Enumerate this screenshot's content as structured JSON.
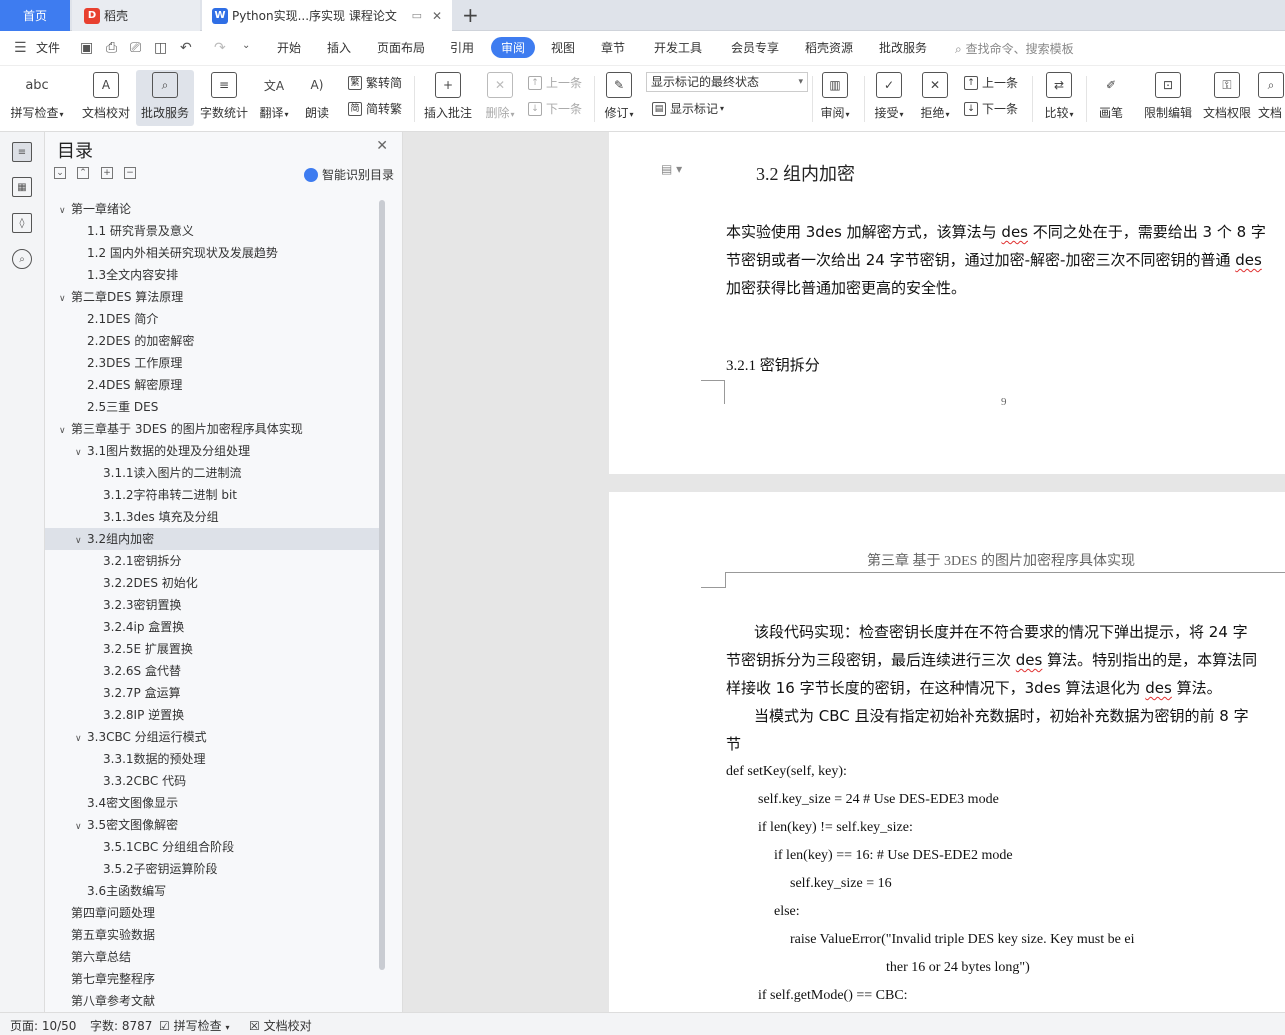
{
  "tabs": {
    "home": "首页",
    "daoke": "稻壳",
    "doc": "Python实现...序实现 课程论文",
    "add": "+"
  },
  "menubar": {
    "file": "文件",
    "items": [
      "开始",
      "插入",
      "页面布局",
      "引用",
      "审阅",
      "视图",
      "章节",
      "开发工具",
      "会员专享",
      "稻壳资源",
      "批改服务"
    ],
    "active": "审阅",
    "search": "查找命令、搜索模板"
  },
  "ribbon": {
    "spell": "拼写检查",
    "doc_check": "文档校对",
    "correct_service": "批改服务",
    "word_count": "字数统计",
    "translate": "翻译",
    "read_aloud": "朗读",
    "trad": "繁转简",
    "simp": "简转繁",
    "insert_comment": "插入批注",
    "delete": "删除",
    "prev": "上一条",
    "next": "下一条",
    "revise": "修订",
    "markup_state": "显示标记的最终状态",
    "show_markup": "显示标记",
    "review": "审阅",
    "accept": "接受",
    "reject": "拒绝",
    "prev2": "上一条",
    "next2": "下一条",
    "compare": "比较",
    "pen": "画笔",
    "restrict": "限制编辑",
    "permission": "文档权限",
    "more": "文档"
  },
  "toc": {
    "title": "目录",
    "smart": "智能识别目录",
    "items": [
      {
        "label": "第一章绪论",
        "level": 0,
        "caret": "∨"
      },
      {
        "label": "1.1  研究背景及意义",
        "level": 1,
        "caret": ""
      },
      {
        "label": "1.2    国内外相关研究现状及发展趋势",
        "level": 1,
        "caret": ""
      },
      {
        "label": "1.3全文内容安排",
        "level": 1,
        "caret": ""
      },
      {
        "label": "第二章DES 算法原理",
        "level": 0,
        "caret": "∨"
      },
      {
        "label": "2.1DES 简介",
        "level": 1,
        "caret": ""
      },
      {
        "label": "2.2DES 的加密解密",
        "level": 1,
        "caret": ""
      },
      {
        "label": "2.3DES 工作原理",
        "level": 1,
        "caret": ""
      },
      {
        "label": "2.4DES 解密原理",
        "level": 1,
        "caret": ""
      },
      {
        "label": "2.5三重 DES",
        "level": 1,
        "caret": ""
      },
      {
        "label": "第三章基于 3DES 的图片加密程序具体实现",
        "level": 0,
        "caret": "∨"
      },
      {
        "label": "3.1图片数据的处理及分组处理",
        "level": 1,
        "caret": "∨"
      },
      {
        "label": "3.1.1读入图片的二进制流",
        "level": 2,
        "caret": ""
      },
      {
        "label": "3.1.2字符串转二进制 bit",
        "level": 2,
        "caret": ""
      },
      {
        "label": "3.1.3des 填充及分组",
        "level": 2,
        "caret": ""
      },
      {
        "label": "3.2组内加密",
        "level": 1,
        "caret": "∨",
        "selected": true
      },
      {
        "label": "3.2.1密钥拆分",
        "level": 2,
        "caret": ""
      },
      {
        "label": "3.2.2DES 初始化",
        "level": 2,
        "caret": ""
      },
      {
        "label": "3.2.3密钥置换",
        "level": 2,
        "caret": ""
      },
      {
        "label": "3.2.4ip 盒置换",
        "level": 2,
        "caret": ""
      },
      {
        "label": "3.2.5E 扩展置换",
        "level": 2,
        "caret": ""
      },
      {
        "label": "3.2.6S 盒代替",
        "level": 2,
        "caret": ""
      },
      {
        "label": "3.2.7P 盒运算",
        "level": 2,
        "caret": ""
      },
      {
        "label": "3.2.8IP 逆置换",
        "level": 2,
        "caret": ""
      },
      {
        "label": "3.3CBC 分组运行模式",
        "level": 1,
        "caret": "∨"
      },
      {
        "label": "3.3.1数据的预处理",
        "level": 2,
        "caret": ""
      },
      {
        "label": "3.3.2CBC 代码",
        "level": 2,
        "caret": ""
      },
      {
        "label": "3.4密文图像显示",
        "level": 1,
        "caret": ""
      },
      {
        "label": "3.5密文图像解密",
        "level": 1,
        "caret": "∨"
      },
      {
        "label": "3.5.1CBC 分组组合阶段",
        "level": 2,
        "caret": ""
      },
      {
        "label": "3.5.2子密钥运算阶段",
        "level": 2,
        "caret": ""
      },
      {
        "label": "3.6主函数编写",
        "level": 1,
        "caret": ""
      },
      {
        "label": "第四章问题处理",
        "level": 0,
        "caret": ""
      },
      {
        "label": "第五章实验数据",
        "level": 0,
        "caret": ""
      },
      {
        "label": "第六章总结",
        "level": 0,
        "caret": ""
      },
      {
        "label": "第七章完整程序",
        "level": 0,
        "caret": ""
      },
      {
        "label": "第八章参考文献",
        "level": 0,
        "caret": ""
      }
    ]
  },
  "page1": {
    "heading": "3.2    组内加密",
    "para": [
      "本实验使用 3des 加解密方式，该算法与 des 不同之处在于，需要给出 3 个 8 字",
      "节密钥或者一次给出 24 字节密钥，通过加密-解密-加密三次不同密钥的普通 des",
      "加密获得比普通加密更高的安全性。"
    ],
    "subheading": "3.2.1   密钥拆分",
    "page_number": "9"
  },
  "page2": {
    "header": "第三章  基于 3DES 的图片加密程序具体实现",
    "para1": [
      "该段代码实现：检查密钥长度并在不符合要求的情况下弹出提示，将 24 字",
      "节密钥拆分为三段密钥，最后连续进行三次 des 算法。特别指出的是，本算法同",
      "样接收 16 字节长度的密钥，在这种情况下，3des 算法退化为 des 算法。"
    ],
    "para2": [
      "当模式为 CBC 且没有指定初始补充数据时，初始补充数据为密钥的前 8 字",
      "节"
    ],
    "code": [
      {
        "text": "def setKey(self, key):",
        "indent": 0
      },
      {
        "text": "self.key_size = 24  # Use DES-EDE3 mode",
        "indent": 1
      },
      {
        "text": "if len(key) != self.key_size:",
        "indent": 1
      },
      {
        "text": "if len(key) == 16: # Use DES-EDE2 mode",
        "indent": 2
      },
      {
        "text": "self.key_size = 16",
        "indent": 3
      },
      {
        "text": "else:",
        "indent": 2
      },
      {
        "text": "raise ValueError(\"Invalid triple DES key size. Key must be ei",
        "indent": 3
      },
      {
        "text": "ther 16 or 24 bytes long\")",
        "indent": 9
      },
      {
        "text": "if self.getMode() == CBC:",
        "indent": 1
      }
    ]
  },
  "status": {
    "page": "页面: 10/50",
    "words": "字数: 8787",
    "spell": "拼写检查",
    "doc_check": "文档校对"
  },
  "colors": {
    "accent": "#3e7cf0",
    "squiggle": "#e03030"
  }
}
